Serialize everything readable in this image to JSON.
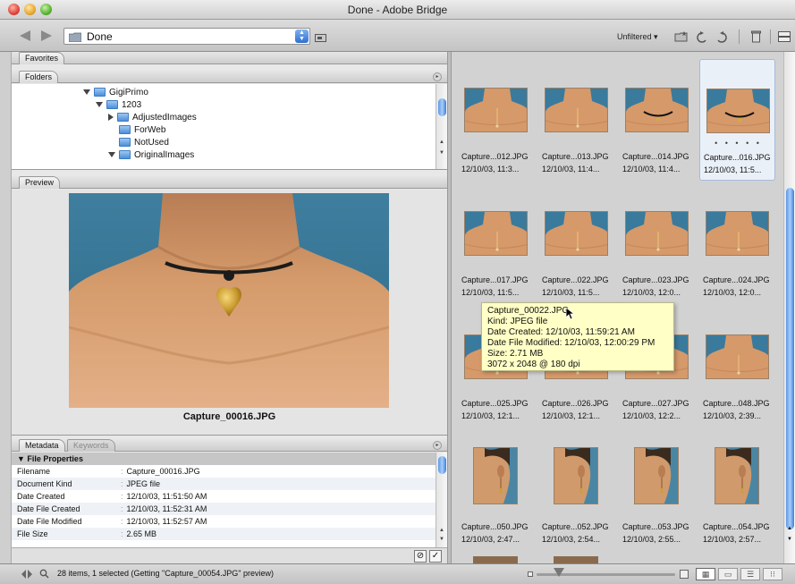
{
  "window": {
    "title": "Done - Adobe Bridge"
  },
  "toolbar": {
    "path": "Done",
    "filter_label": "Unfiltered"
  },
  "panels": {
    "favorites_tab": "Favorites",
    "folders_tab": "Folders",
    "preview_tab": "Preview",
    "metadata_tab": "Metadata",
    "keywords_tab": "Keywords"
  },
  "folders": [
    {
      "label": "GigiPrimo",
      "expanded": true,
      "depth": 0
    },
    {
      "label": "1203",
      "expanded": true,
      "depth": 1
    },
    {
      "label": "AdjustedImages",
      "expanded": false,
      "depth": 2
    },
    {
      "label": "ForWeb",
      "expanded": null,
      "depth": 2
    },
    {
      "label": "NotUsed",
      "expanded": null,
      "depth": 2
    },
    {
      "label": "OriginalImages",
      "expanded": true,
      "depth": 2
    }
  ],
  "preview": {
    "caption": "Capture_00016.JPG"
  },
  "metadata": {
    "section": "File Properties",
    "rows": [
      {
        "key": "Filename",
        "value": "Capture_00016.JPG"
      },
      {
        "key": "Document Kind",
        "value": "JPEG file"
      },
      {
        "key": "Date Created",
        "value": "12/10/03, 11:51:50 AM"
      },
      {
        "key": "Date File Created",
        "value": "12/10/03, 11:52:31 AM"
      },
      {
        "key": "Date File Modified",
        "value": "12/10/03, 11:52:57 AM"
      },
      {
        "key": "File Size",
        "value": "2.65 MB"
      }
    ]
  },
  "thumbnails": [
    {
      "name": "Capture...012.JPG",
      "date": "12/10/03, 11:3...",
      "style": "chest"
    },
    {
      "name": "Capture...013.JPG",
      "date": "12/10/03, 11:4...",
      "style": "chest"
    },
    {
      "name": "Capture...014.JPG",
      "date": "12/10/03, 11:4...",
      "style": "choker"
    },
    {
      "name": "Capture...016.JPG",
      "date": "12/10/03, 11:5...",
      "style": "choker",
      "selected": true
    },
    {
      "name": "Capture...017.JPG",
      "date": "12/10/03, 11:5...",
      "style": "chest"
    },
    {
      "name": "Capture...022.JPG",
      "date": "12/10/03, 11:5...",
      "style": "chest"
    },
    {
      "name": "Capture...023.JPG",
      "date": "12/10/03, 12:0...",
      "style": "chest"
    },
    {
      "name": "Capture...024.JPG",
      "date": "12/10/03, 12:0...",
      "style": "chest"
    },
    {
      "name": "Capture...025.JPG",
      "date": "12/10/03, 12:1...",
      "style": "chest"
    },
    {
      "name": "Capture...026.JPG",
      "date": "12/10/03, 12:1...",
      "style": "chest"
    },
    {
      "name": "Capture...027.JPG",
      "date": "12/10/03, 12:2...",
      "style": "chest"
    },
    {
      "name": "Capture...048.JPG",
      "date": "12/10/03, 2:39...",
      "style": "chest"
    },
    {
      "name": "Capture...050.JPG",
      "date": "12/10/03, 2:47...",
      "style": "ear"
    },
    {
      "name": "Capture...052.JPG",
      "date": "12/10/03, 2:54...",
      "style": "ear"
    },
    {
      "name": "Capture...053.JPG",
      "date": "12/10/03, 2:55...",
      "style": "ear"
    },
    {
      "name": "Capture...054.JPG",
      "date": "12/10/03, 2:57...",
      "style": "ear"
    }
  ],
  "tooltip": {
    "lines": [
      "Capture_00022.JPG",
      "Kind: JPEG file",
      "Date Created: 12/10/03, 11:59:21 AM",
      "Date File Modified: 12/10/03, 12:00:29 PM",
      "Size: 2.71 MB",
      "3072 x 2048 @ 180 dpi"
    ]
  },
  "status": {
    "text": "28 items, 1 selected (Getting \"Capture_00054.JPG\" preview)"
  },
  "colors": {
    "accent": "#3d7fd9",
    "tooltip_bg": "#ffffc6",
    "backdrop": "#3f7e9e",
    "skin": "#d49a6a"
  }
}
